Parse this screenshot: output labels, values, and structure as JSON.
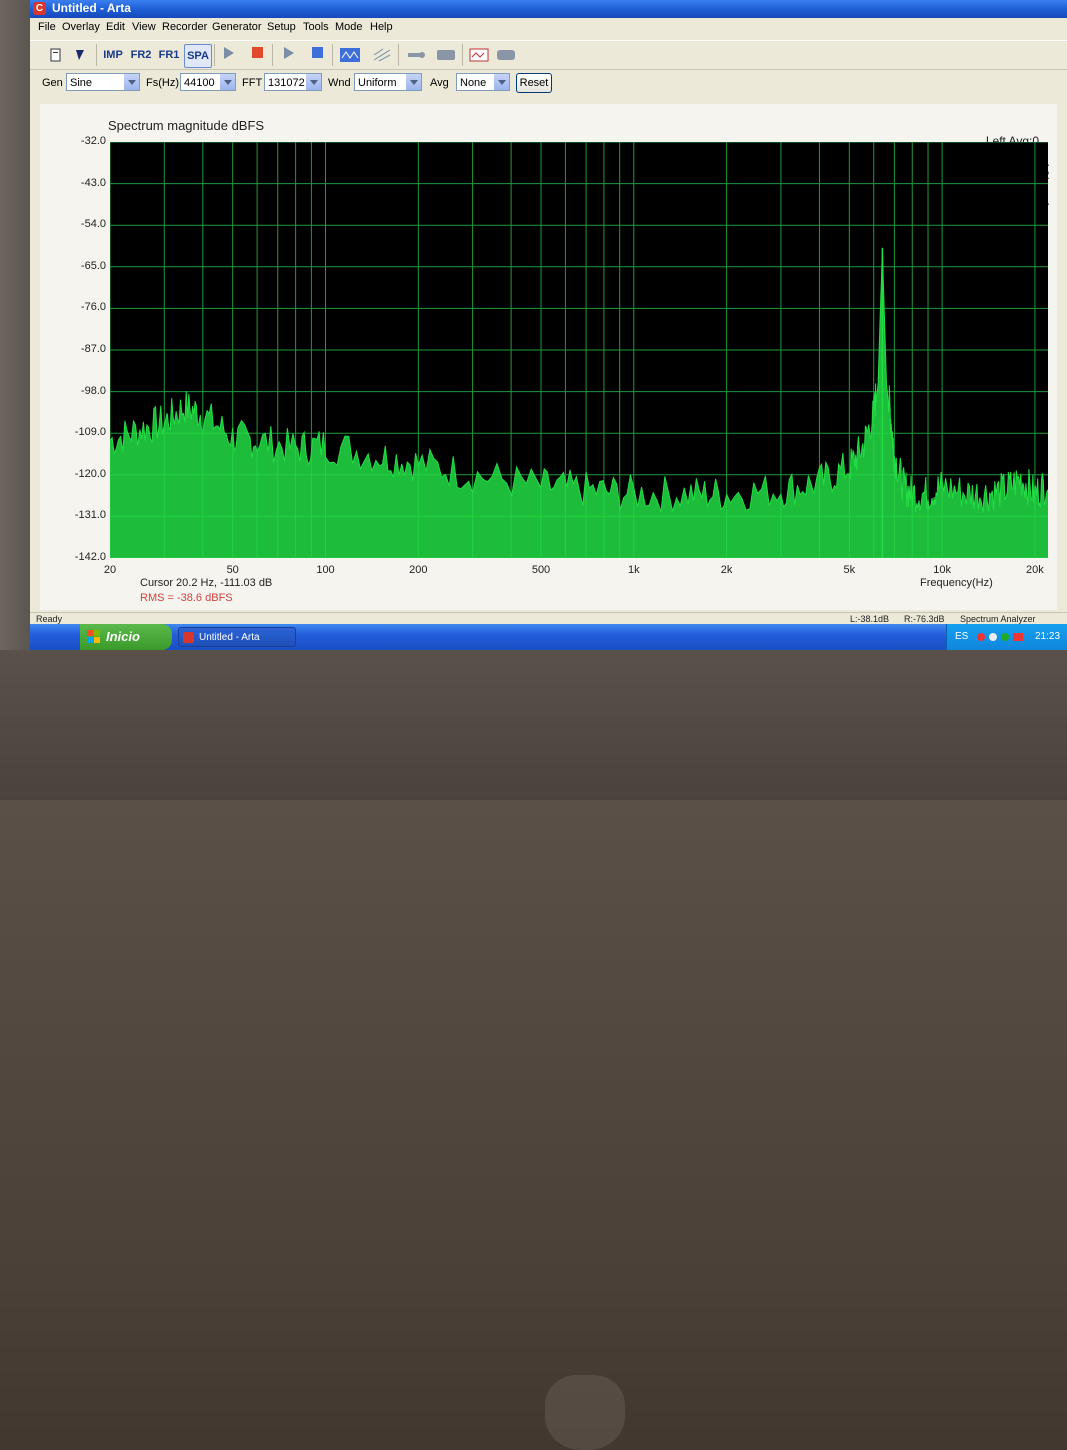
{
  "window": {
    "title": "Untitled - Arta",
    "app_icon_glyph": "C"
  },
  "menu": [
    "File",
    "Overlay",
    "Edit",
    "View",
    "Recorder",
    "Generator",
    "Setup",
    "Tools",
    "Mode",
    "Help"
  ],
  "toolbar": {
    "imp_label": "IMP",
    "fr2_label": "FR2",
    "fr1_label": "FR1",
    "spa_label": "SPA",
    "active": "SPA"
  },
  "controls": {
    "gen_label": "Gen",
    "gen_value": "Sine",
    "fs_label": "Fs(Hz)",
    "fs_value": "44100",
    "fft_label": "FFT",
    "fft_value": "131072",
    "wnd_label": "Wnd",
    "wnd_value": "Uniform",
    "avg_label": "Avg",
    "avg_value": "None",
    "reset_label": "Reset"
  },
  "plot": {
    "title": "Spectrum magnitude dBFS",
    "status": "Left  Avg:0",
    "side_letters": [
      "A",
      "R",
      "T",
      "A"
    ],
    "cursor_text": "Cursor   20.2 Hz, -111.03 dB",
    "rms_text": "RMS =  -38.6 dBFS",
    "xlabel": "Frequency(Hz)"
  },
  "chart_data": {
    "type": "line",
    "title": "Spectrum magnitude dBFS",
    "xlabel": "Frequency(Hz)",
    "ylabel": "",
    "x_scale": "log",
    "xlim": [
      20,
      22050
    ],
    "ylim": [
      -142.0,
      -32.0
    ],
    "grid": true,
    "y_ticks": [
      "-32.0",
      "-43.0",
      "-54.0",
      "-65.0",
      "-76.0",
      "-87.0",
      "-98.0",
      "-109.0",
      "-120.0",
      "-131.0",
      "-142.0"
    ],
    "x_ticks": [
      "20",
      "50",
      "100",
      "200",
      "500",
      "1k",
      "2k",
      "5k",
      "10k",
      "20k"
    ],
    "x_tick_values": [
      20,
      50,
      100,
      200,
      500,
      1000,
      2000,
      5000,
      10000,
      20000
    ],
    "series": [
      {
        "color": "#22dd44",
        "x": [
          20,
          25,
          30,
          35,
          40,
          50,
          60,
          80,
          100,
          150,
          200,
          300,
          500,
          700,
          1000,
          1500,
          2000,
          3000,
          4000,
          5000,
          5500,
          6000,
          6200,
          6400,
          6600,
          6800,
          7000,
          7500,
          8000,
          9000,
          10000,
          12000,
          14000,
          16000,
          18000,
          20000,
          22050
        ],
        "y": [
          -113,
          -110,
          -108,
          -104,
          -106,
          -112,
          -113,
          -115,
          -114,
          -117,
          -119,
          -122,
          -125,
          -126,
          -127,
          -127,
          -127,
          -126,
          -124,
          -120,
          -115,
          -106,
          -96,
          -60,
          -96,
          -106,
          -117,
          -125,
          -127,
          -127,
          -125,
          -127,
          -127,
          -126,
          -123,
          -127,
          -124
        ]
      }
    ],
    "colors": {
      "background": "#000000",
      "grid": "#1f9a3a",
      "trace": "#22dd44"
    }
  },
  "status_bar": {
    "ready": "Ready",
    "left_level": "L:-38.1dB",
    "right_level": "R:-76.3dB",
    "mode": "Spectrum Analyzer"
  },
  "taskbar": {
    "start_label": "Inicio",
    "task_label": "Untitled - Arta",
    "lang": "ES",
    "clock": "21:23"
  }
}
